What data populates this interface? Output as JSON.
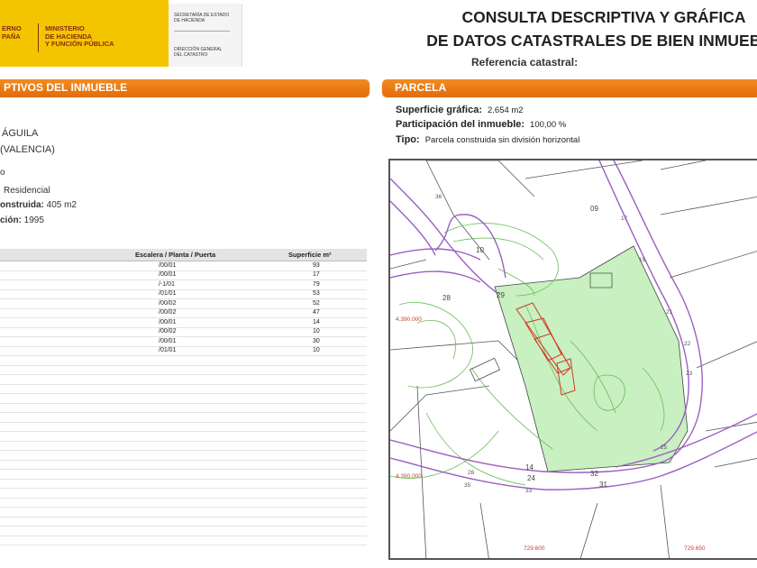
{
  "header": {
    "logo_col1": [
      "GOBIERNO",
      "DE ESPAÑA"
    ],
    "logo_col2": [
      "MINISTERIO",
      "DE HACIENDA",
      "Y FUNCIÓN PÚBLICA"
    ],
    "logo_col1_visible": [
      "ERNO",
      "PAÑA"
    ],
    "secretaria": [
      "SECRETARÍA DE ESTADO",
      "DE HACIENDA"
    ],
    "direccion": [
      "DIRECCIÓN GENERAL",
      "DEL CATASTRO"
    ],
    "title_line1": "CONSULTA DESCRIPTIVA Y GRÁFICA",
    "title_line2": "DE DATOS CATASTRALES DE BIEN INMUEBLE",
    "reference_label": "Referencia catastral:"
  },
  "left_section": {
    "band_prefix": "PTIVOS DEL",
    "band_strong": "INMUEBLE",
    "address_line1": "ÁGUILA",
    "address_line2": "(VALENCIA)",
    "class_fragment": "o",
    "use_value": "Residencial",
    "built_label": "onstruida:",
    "built_value": "405 m2",
    "year_label": "ción:",
    "year_value": "1995"
  },
  "units_table": {
    "headers": {
      "epp": "Escalera / Planta / Puerta",
      "surface": "Superficie m²"
    },
    "rows": [
      {
        "epp": "/00/01",
        "surface": "93"
      },
      {
        "epp": "/00/01",
        "surface": "17"
      },
      {
        "epp": "/-1/01",
        "surface": "79"
      },
      {
        "epp": "/01/01",
        "surface": "53"
      },
      {
        "epp": "/00/02",
        "surface": "52"
      },
      {
        "epp": "/00/02",
        "surface": "47"
      },
      {
        "epp": "/00/01",
        "surface": "14"
      },
      {
        "epp": "/00/02",
        "surface": "10"
      },
      {
        "epp": "/00/01",
        "surface": "30"
      },
      {
        "epp": "/01/01",
        "surface": "10"
      }
    ],
    "empty_rows": 20
  },
  "parcela": {
    "band_title": "PARCELA",
    "surface_label": "Superficie gráfica:",
    "surface_value": "2.654 m2",
    "participation_label": "Participación del inmueble:",
    "participation_value": "100,00 %",
    "type_label": "Tipo:",
    "type_value": "Parcela construida sin división horizontal"
  },
  "map": {
    "parcel_numbers": [
      "09",
      "10",
      "28",
      "29",
      "14",
      "24",
      "32",
      "31"
    ],
    "street_numbers": [
      "17",
      "19",
      "21",
      "22",
      "23",
      "25",
      "26",
      "33",
      "35",
      "36"
    ],
    "coordinates": [
      "4.390.000",
      "4.390.000",
      "729.600",
      "729.650"
    ],
    "colors": {
      "parcel_fill": "#c8f0c0",
      "road_line": "#9b5fc0",
      "contour": "#6cbd5a",
      "text_red": "#d23a2a"
    }
  }
}
